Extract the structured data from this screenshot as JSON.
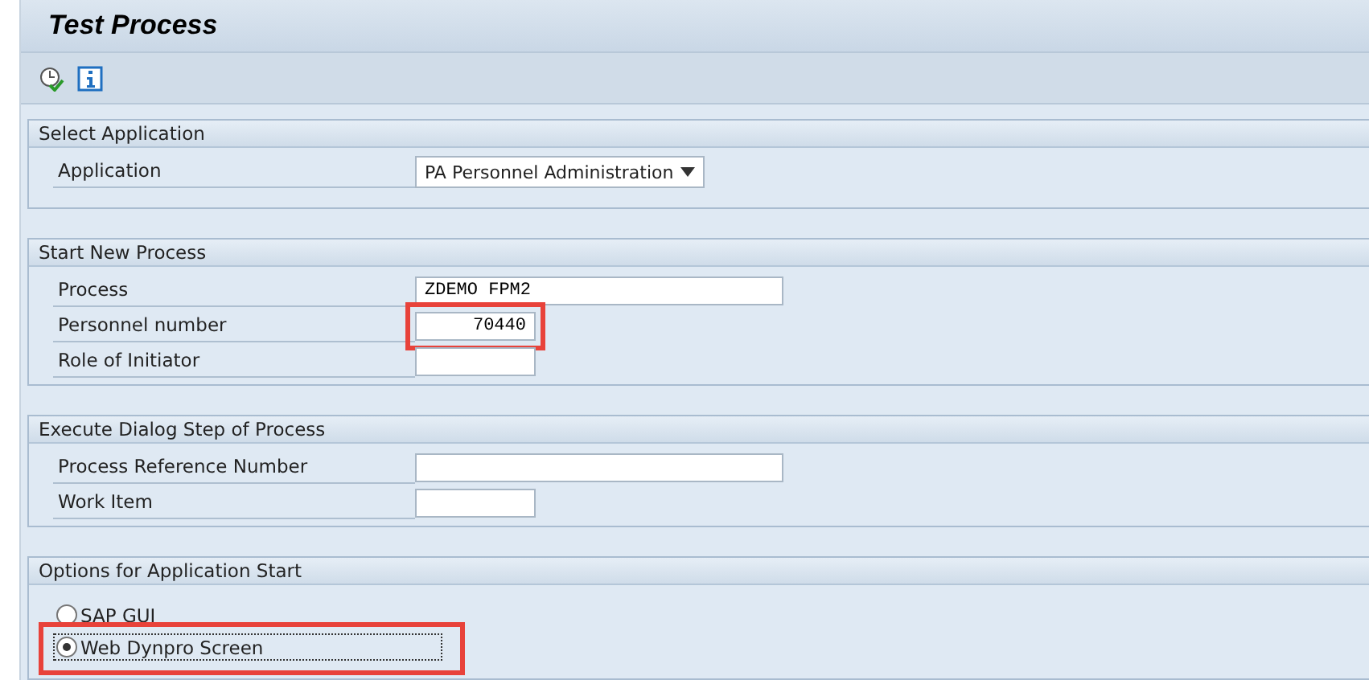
{
  "title": "Test Process",
  "toolbar": [
    {
      "kind": "execute"
    },
    {
      "kind": "info"
    }
  ],
  "groups": [
    {
      "title": "Select Application",
      "rows": [
        {
          "label": "Application",
          "kind": "dropdown",
          "value": "PA Personnel Administration",
          "highlighted": false
        }
      ]
    },
    {
      "title": "Start New Process",
      "rows": [
        {
          "label": "Process",
          "kind": "long_field",
          "value": "ZDEMO FPM2",
          "highlighted": false
        },
        {
          "label": "Personnel number",
          "kind": "number_field",
          "value": "70440",
          "highlighted": true
        },
        {
          "label": "Role of Initiator",
          "kind": "short_field",
          "highlighted": false
        }
      ]
    },
    {
      "title": "Execute Dialog Step of Process",
      "rows": [
        {
          "label": "Process Reference Number",
          "kind": "long_field",
          "highlighted": false
        },
        {
          "label": "Work Item",
          "kind": "short_field",
          "highlighted": false
        }
      ]
    },
    {
      "title": "Options for Application Start",
      "options": [
        {
          "label": "SAP GUI",
          "selected": false,
          "highlighted": false
        },
        {
          "label": "Web Dynpro Screen",
          "selected": true,
          "highlighted": true
        }
      ]
    }
  ]
}
